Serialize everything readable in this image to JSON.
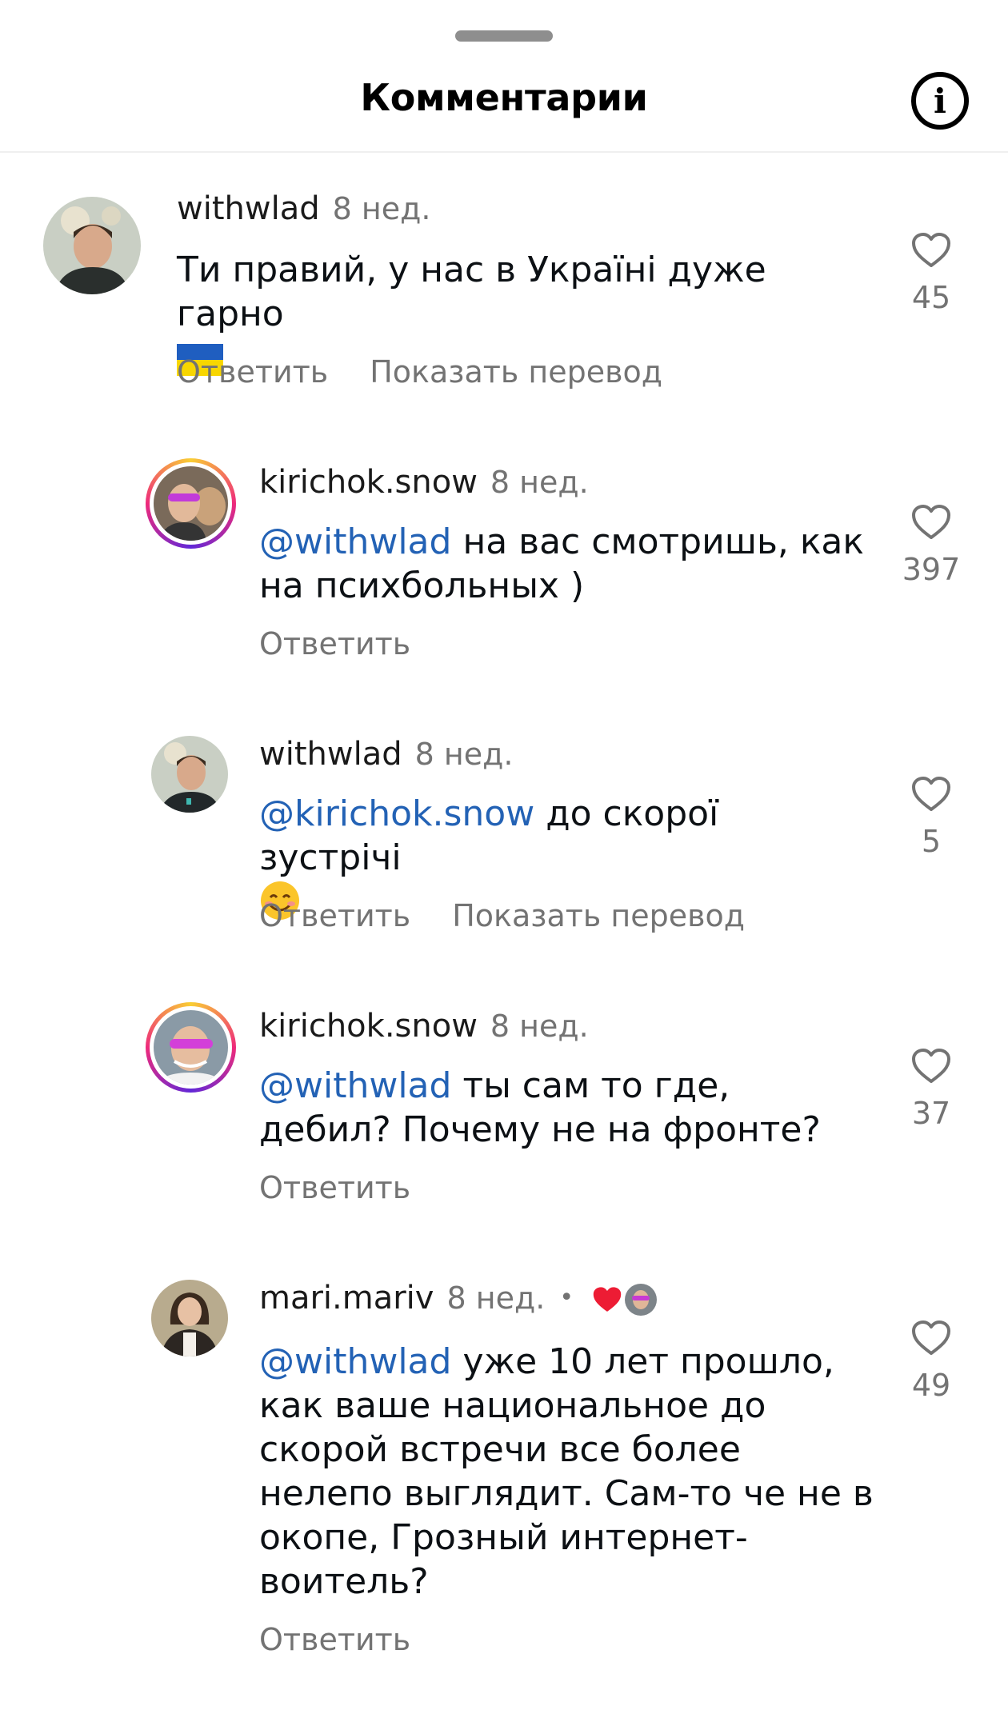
{
  "header": {
    "title": "Комментарии",
    "info_label": "i"
  },
  "comments": [
    {
      "username": "withwlad",
      "time": "8 нед.",
      "text": "Ти правий, у нас в Україні дуже гарно",
      "likes": "45",
      "reply": "Ответить",
      "translate": "Показать перевод"
    },
    {
      "username": "kirichok.snow",
      "time": "8 нед.",
      "mention": "@withwlad",
      "text": " на вас смотришь, как на психбольных )",
      "likes": "397",
      "reply": "Ответить"
    },
    {
      "username": "withwlad",
      "time": "8 нед.",
      "mention": "@kirichok.snow",
      "text": " до скорої зустрічі",
      "likes": "5",
      "reply": "Ответить",
      "translate": "Показать перевод"
    },
    {
      "username": "kirichok.snow",
      "time": "8 нед.",
      "mention": "@withwlad",
      "text": " ты сам то где, дебил? Почему не на фронте?",
      "likes": "37",
      "reply": "Ответить"
    },
    {
      "username": "mari.mariv",
      "time": "8 нед.",
      "separator": "•",
      "mention": "@withwlad",
      "text": " уже 10 лет прошло, как ваше национальное до скорой встречи все более нелепо выглядит.  Сам-то че не в окопе, Грозный интернет-воитель?",
      "likes": "49",
      "reply": "Ответить"
    }
  ],
  "icons": {
    "like": "heart-outline-icon",
    "author_like": "heart-filled-icon",
    "info": "info-circle-icon"
  },
  "colors": {
    "mention": "#2362b5",
    "secondary_text": "#737373",
    "author_heart": "#ed1c34"
  }
}
